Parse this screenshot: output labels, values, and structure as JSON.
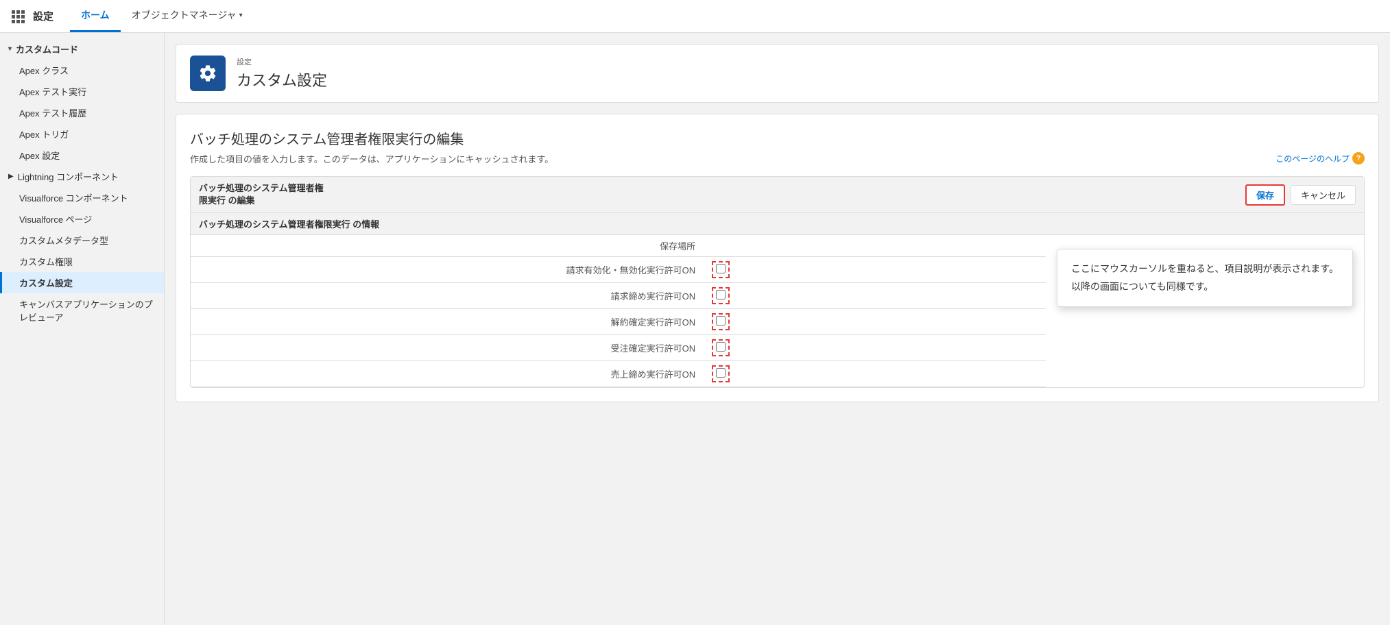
{
  "nav": {
    "brand": "設定",
    "tabs": [
      {
        "label": "ホーム",
        "active": true
      },
      {
        "label": "オブジェクトマネージャ",
        "has_arrow": true
      }
    ]
  },
  "sidebar": {
    "sections": [
      {
        "label": "カスタムコード",
        "expanded": true,
        "items": [
          {
            "label": "Apex クラス",
            "active": false
          },
          {
            "label": "Apex テスト実行",
            "active": false
          },
          {
            "label": "Apex テスト履歴",
            "active": false
          },
          {
            "label": "Apex トリガ",
            "active": false
          },
          {
            "label": "Apex 設定",
            "active": false
          }
        ]
      },
      {
        "label": "Lightning コンポーネント",
        "expanded": false,
        "items": []
      },
      {
        "label": "Visualforce コンポーネント",
        "expanded": false,
        "items": []
      },
      {
        "label": "Visualforce ページ",
        "expanded": false,
        "items": []
      },
      {
        "label": "カスタムメタデータ型",
        "expanded": false,
        "items": []
      },
      {
        "label": "カスタム権限",
        "expanded": false,
        "items": []
      },
      {
        "label": "カスタム設定",
        "active": true,
        "expanded": false,
        "items": []
      },
      {
        "label": "キャンバスアプリケーションのプレビューア",
        "expanded": false,
        "items": []
      }
    ]
  },
  "page_header": {
    "subtitle": "設定",
    "title": "カスタム設定",
    "icon_label": "gear-icon"
  },
  "main": {
    "page_title": "バッチ処理のシステム管理者権限実行の編集",
    "page_subtitle": "作成した項目の値を入力します。このデータは、アプリケーションにキャッシュされます。",
    "help_link": "このページのヘルプ",
    "form": {
      "toolbar_label": "バッチ処理のシステム管理者権\n限実行 の編集",
      "save_button": "保存",
      "cancel_button": "キャンセル",
      "section_header": "バッチ処理のシステム管理者権限実行 の情報",
      "rows": [
        {
          "label": "保存場所",
          "value": ""
        },
        {
          "label": "請求有効化・無効化実行許可ON",
          "value": ""
        },
        {
          "label": "請求締め実行許可ON",
          "value": ""
        },
        {
          "label": "解約確定実行許可ON",
          "value": ""
        },
        {
          "label": "受注確定実行許可ON",
          "value": ""
        },
        {
          "label": "売上締め実行許可ON",
          "value": ""
        }
      ]
    },
    "tooltip": {
      "line1": "ここにマウスカーソルを重ねると、項目説明が表示されます。",
      "line2": "以降の画面についても同様です。"
    }
  }
}
